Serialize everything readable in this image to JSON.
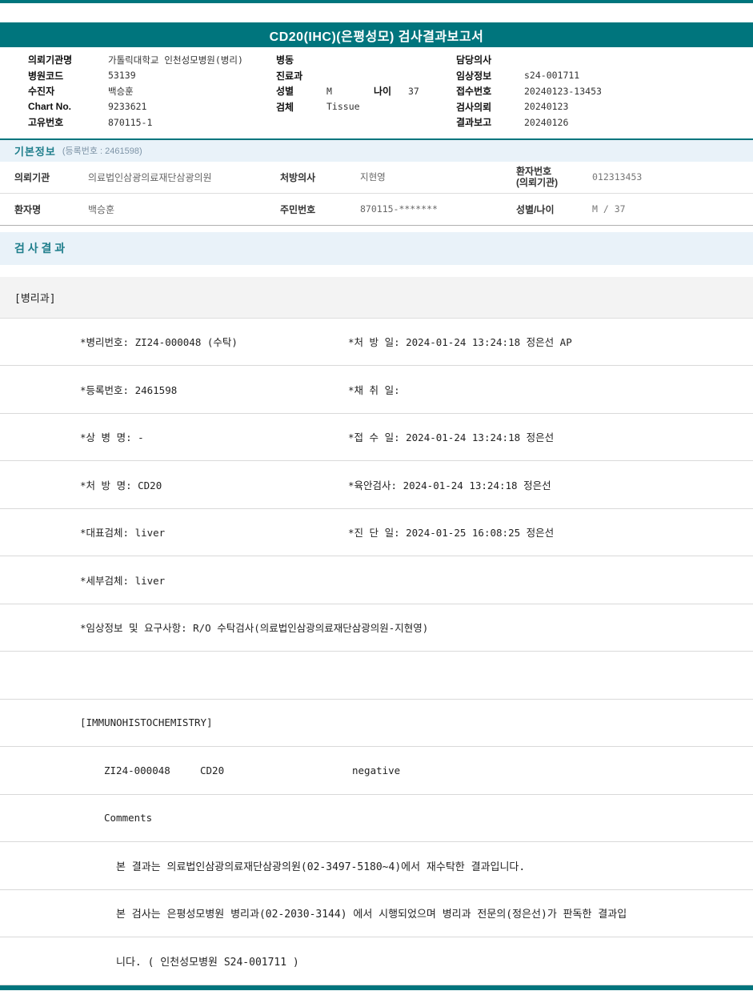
{
  "colors": {
    "teal": "#00757d",
    "section_bg": "#e9f2f9",
    "section_text": "#1f7e8c"
  },
  "title": "CD20(IHC)(은평성모) 검사결과보고서",
  "header": {
    "left": [
      {
        "label": "의뢰기관명",
        "value": "가톨릭대학교 인천성모병원(병리)"
      },
      {
        "label": "병원코드",
        "value": "53139"
      },
      {
        "label": "수진자",
        "value": "백승훈"
      },
      {
        "label": "Chart No.",
        "value": "9233621"
      },
      {
        "label": "고유번호",
        "value": "870115-1"
      }
    ],
    "middle": [
      {
        "label": "병동",
        "value": ""
      },
      {
        "label": "진료과",
        "value": ""
      },
      {
        "label": "성별",
        "value": "M"
      },
      {
        "label": "검체",
        "value": "Tissue"
      }
    ],
    "age": {
      "label": "나이",
      "value": "37"
    },
    "right": [
      {
        "label": "담당의사",
        "value": ""
      },
      {
        "label": "임상정보",
        "value": "s24-001711"
      },
      {
        "label": "접수번호",
        "value": "20240123-13453"
      },
      {
        "label": "검사의뢰",
        "value": "20240123"
      },
      {
        "label": "결과보고",
        "value": "20240126"
      }
    ]
  },
  "basic_info": {
    "heading": "기본정보",
    "reg_no": "(등록번호 : 2461598)",
    "row1": {
      "l1": "의뢰기관",
      "v1": "의료법인삼광의료재단삼광의원",
      "l2": "처방의사",
      "v2": "지현영",
      "l3a": "환자번호",
      "l3b": "(의뢰기관)",
      "v3": "012313453"
    },
    "row2": {
      "l1": "환자명",
      "v1": "백승훈",
      "l2": "주민번호",
      "v2": "870115-*******",
      "l3": "성별/나이",
      "v3": "M / 37"
    }
  },
  "results": {
    "heading": "검 사 결 과",
    "department": "[병리과]",
    "detail_rows": [
      {
        "left": "*병리번호: ZI24-000048 (수탁)",
        "right": "*처 방 일: 2024-01-24 13:24:18  정은선 AP"
      },
      {
        "left": "*등록번호: 2461598",
        "right": "*채 취 일:"
      },
      {
        "left": "*상 병 명: -",
        "right": "*접 수 일: 2024-01-24 13:24:18  정은선"
      },
      {
        "left": "*처 방 명: CD20",
        "right": "*육안검사: 2024-01-24 13:24:18  정은선"
      },
      {
        "left": "*대표검체: liver",
        "right": "*진 단 일: 2024-01-25 16:08:25  정은선"
      },
      {
        "left": "*세부검체: liver",
        "right": ""
      },
      {
        "left": "*임상정보 및 요구사항: R/O 수탁검사(의료법인삼광의료재단삼광의원-지현영)",
        "right": ""
      }
    ],
    "section_title": "[IMMUNOHISTOCHEMISTRY]",
    "result_line": {
      "specimen": "ZI24-000048",
      "test": "CD20",
      "result": "negative"
    },
    "comments_label": "Comments",
    "footnotes": [
      "본 결과는 의료법인삼광의료재단삼광의원(02-3497-5180~4)에서 재수탁한 결과입니다.",
      "본 검사는 은평성모병원 병리과(02-2030-3144) 에서 시행되었으며 병리과 전문의(정은선)가 판독한 결과입",
      "니다. ( 인천성모병원 S24-001711 )"
    ]
  }
}
